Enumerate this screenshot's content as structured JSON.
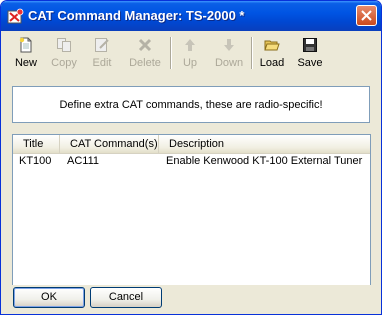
{
  "window": {
    "title": "CAT Command Manager: TS-2000 *",
    "icon": "app-icon",
    "close_icon": "close-icon"
  },
  "toolbar": {
    "buttons": [
      {
        "label": "New",
        "icon": "new-document-icon",
        "enabled": true
      },
      {
        "label": "Copy",
        "icon": "copy-icon",
        "enabled": false
      },
      {
        "label": "Edit",
        "icon": "edit-icon",
        "enabled": false
      },
      {
        "label": "Delete",
        "icon": "delete-icon",
        "enabled": false
      },
      {
        "label": "Up",
        "icon": "arrow-up-icon",
        "enabled": false
      },
      {
        "label": "Down",
        "icon": "arrow-down-icon",
        "enabled": false
      },
      {
        "label": "Load",
        "icon": "folder-open-icon",
        "enabled": true
      },
      {
        "label": "Save",
        "icon": "floppy-disk-icon",
        "enabled": true
      }
    ]
  },
  "info": {
    "text": "Define extra CAT commands, these are radio-specific!"
  },
  "list": {
    "columns": [
      "Title",
      "CAT Command(s)",
      "Description"
    ],
    "rows": [
      [
        "KT100",
        "AC111",
        "Enable Kenwood KT-100 External Tuner"
      ]
    ]
  },
  "footer": {
    "ok_label": "OK",
    "cancel_label": "Cancel"
  },
  "colors": {
    "titlebar": "#0054e3",
    "disabled_text": "#aca899",
    "list_border": "#7f9db9"
  }
}
